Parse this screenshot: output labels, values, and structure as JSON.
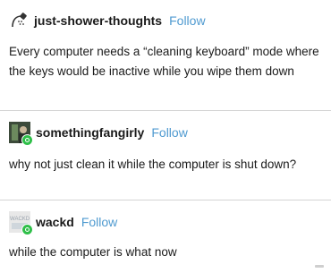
{
  "posts": [
    {
      "username": "just-shower-thoughts",
      "follow_label": "Follow",
      "avatar_icon": "shower-head-icon",
      "text": "Every computer needs a “cleaning keyboard” mode where the keys would be inactive while you wipe them down"
    },
    {
      "username": "somethingfangirly",
      "follow_label": "Follow",
      "avatar_icon": "user-avatar-icon",
      "text": "why not just clean it while the computer is shut down?"
    },
    {
      "username": "wackd",
      "follow_label": "Follow",
      "avatar_icon": "user-avatar-icon",
      "avatar_text": "WACKD",
      "text": "while the computer is what now"
    }
  ],
  "colors": {
    "follow": "#4f9ad0",
    "badge": "#2fbf49",
    "divider": "#d4d4d4"
  }
}
